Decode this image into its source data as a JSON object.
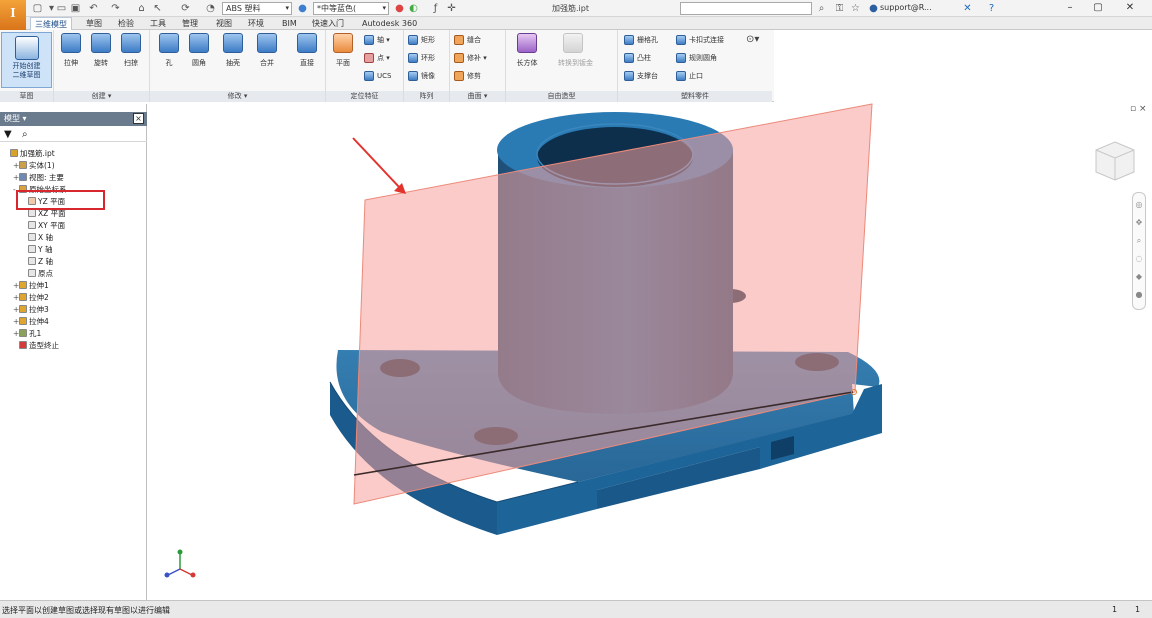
{
  "quick_access": {
    "app_letter": "I",
    "material": "ABS 塑料",
    "appearance": "*中等蓝色(",
    "document_title": "加强筋.ipt",
    "user": "support@R..."
  },
  "ribbon_tabs": [
    {
      "label": "三维模型",
      "active": true
    },
    {
      "label": "草图"
    },
    {
      "label": "检验"
    },
    {
      "label": "工具"
    },
    {
      "label": "管理"
    },
    {
      "label": "视图"
    },
    {
      "label": "环境"
    },
    {
      "label": "BIM"
    },
    {
      "label": "快速入门"
    },
    {
      "label": "Autodesk 360"
    }
  ],
  "ribbon": {
    "sketch": {
      "start_label_1": "开始创建",
      "start_label_2": "二维草图",
      "panel": "草图"
    },
    "create": {
      "panel": "创建 ▾",
      "extrude": "拉伸",
      "revolve": "旋转",
      "sweep": "扫掠"
    },
    "modify": {
      "panel": "修改 ▾",
      "hole": "孔",
      "fillet": "圆角",
      "shell": "抽壳",
      "combine": "合并",
      "direct": "直接"
    },
    "work_features": {
      "panel": "定位特征",
      "plane": "平面",
      "axis": "轴 ▾",
      "point": "点 ▾",
      "ucs": "UCS"
    },
    "pattern": {
      "panel": "阵列",
      "rectangular": "矩形",
      "circular": "环形",
      "mirror": "镜像"
    },
    "surface": {
      "panel": "曲面 ▾",
      "stitch": "缝合",
      "thicken": "修补 ▾",
      "trim": "修剪"
    },
    "freeform": {
      "panel": "自由造型",
      "box": "长方体"
    },
    "convert": {
      "label": "转换到钣金"
    },
    "plastic": {
      "panel": "塑料零件",
      "grill": "栅格孔",
      "snap": "卡扣式连接",
      "rule_fillet": "凸柱",
      "rest": "规则圆角",
      "boss": "支撑台",
      "lip": "止口"
    }
  },
  "browser": {
    "title": "模型 ▾",
    "items": [
      {
        "label": "加强筋.ipt",
        "indent": 0,
        "color": "#d8a32a",
        "expander": ""
      },
      {
        "label": "实体(1)",
        "indent": 1,
        "color": "#caa04a",
        "expander": "+"
      },
      {
        "label": "视图: 主要",
        "indent": 1,
        "color": "#6f8bb3",
        "expander": "+"
      },
      {
        "label": "原始坐标系",
        "indent": 1,
        "color": "#d9a23b",
        "expander": "-"
      },
      {
        "label": "YZ 平面",
        "indent": 2,
        "color": "#f1c9a8",
        "expander": ""
      },
      {
        "label": "XZ 平面",
        "indent": 2,
        "color": "#e6e6e6",
        "expander": ""
      },
      {
        "label": "XY 平面",
        "indent": 2,
        "color": "#e6e6e6",
        "expander": ""
      },
      {
        "label": "X 轴",
        "indent": 2,
        "color": "#e6e6e6",
        "expander": ""
      },
      {
        "label": "Y 轴",
        "indent": 2,
        "color": "#e6e6e6",
        "expander": ""
      },
      {
        "label": "Z 轴",
        "indent": 2,
        "color": "#e6e6e6",
        "expander": ""
      },
      {
        "label": "原点",
        "indent": 2,
        "color": "#e6e6e6",
        "expander": ""
      },
      {
        "label": "拉伸1",
        "indent": 1,
        "color": "#e0a52f",
        "expander": "+"
      },
      {
        "label": "拉伸2",
        "indent": 1,
        "color": "#e0a52f",
        "expander": "+"
      },
      {
        "label": "拉伸3",
        "indent": 1,
        "color": "#e0a52f",
        "expander": "+"
      },
      {
        "label": "拉伸4",
        "indent": 1,
        "color": "#e0a52f",
        "expander": "+"
      },
      {
        "label": "孔1",
        "indent": 1,
        "color": "#8aa35a",
        "expander": "+"
      },
      {
        "label": "造型终止",
        "indent": 1,
        "color": "#d63b3b",
        "expander": ""
      }
    ]
  },
  "status": {
    "message": "选择平面以创建草图或选择现有草图以进行编辑",
    "count_a": "1",
    "count_b": "1"
  },
  "colors": {
    "part_body": "#1f5f8f",
    "work_plane": "#f4a8a0",
    "highlight": "#d8262e",
    "arrow": "#e2332d"
  }
}
